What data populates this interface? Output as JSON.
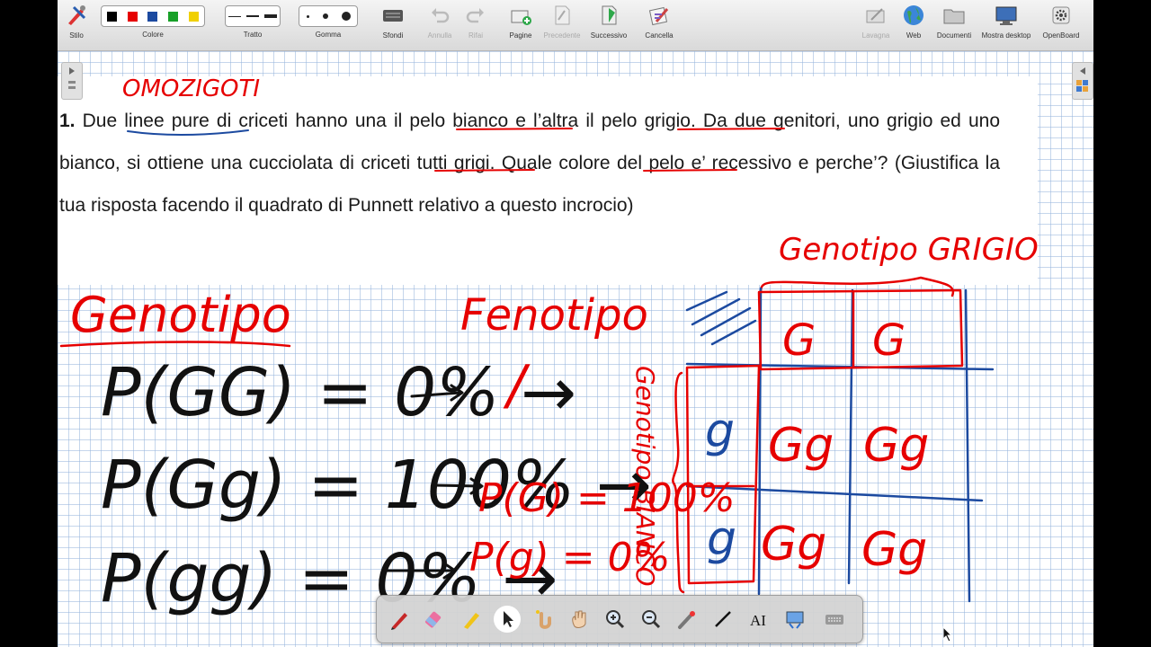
{
  "toolbar": {
    "stylus": "Stilo",
    "color": "Colore",
    "stroke": "Tratto",
    "eraser": "Gomma",
    "backgrounds": "Sfondi",
    "undo": "Annulla",
    "redo": "Rifai",
    "pages": "Pagine",
    "previous": "Precedente",
    "next": "Successivo",
    "clear": "Cancella",
    "board": "Lavagna",
    "web": "Web",
    "documents": "Documenti",
    "show_desktop": "Mostra desktop",
    "openboard": "OpenBoard",
    "colors": [
      "#000000",
      "#e60000",
      "#1c4aa0",
      "#18a028",
      "#f0d000"
    ]
  },
  "problem": {
    "number": "1.",
    "text": " Due linee pure di criceti hanno una il pelo bianco e l’altra il pelo grigio. Da due genitori, uno grigio ed uno bianco, si ottiene una cucciolata di criceti tutti grigi. Quale colore del pelo e’ recessivo e perche’? (Giustifica la tua risposta facendo il quadrato di Punnett relativo a questo incrocio)"
  },
  "handwriting": {
    "omozigoti": "OMOZIGOTI",
    "genotipo_heading": "Genotipo",
    "fenotipo_heading": "Fenotipo",
    "genotipo_grigio": "Genotipo GRIGIO",
    "genotipo_bianco": "Genotipo BIANCO",
    "eq_gg_upper": "P(GG) = 0% →",
    "eq_gg_mixed": "P(Gg) = 100% →",
    "eq_gg_lower": "P(gg) = 0% →",
    "phen_dash": "/",
    "phen_g_upper": "P(G) = 100%",
    "phen_g_lower": "P(g) = 0%",
    "punnett_top": [
      "G",
      "G"
    ],
    "punnett_left": [
      "g",
      "g"
    ],
    "punnett_cells": [
      "Gg",
      "Gg",
      "Gg",
      "Gg"
    ]
  },
  "palette_tools": [
    "pen-icon",
    "eraser-icon",
    "marker-icon",
    "selector-icon",
    "interact-icon",
    "hand-icon",
    "zoom-in-icon",
    "zoom-out-icon",
    "laser-icon",
    "line-icon",
    "text-icon",
    "capture-icon",
    "keyboard-icon"
  ]
}
